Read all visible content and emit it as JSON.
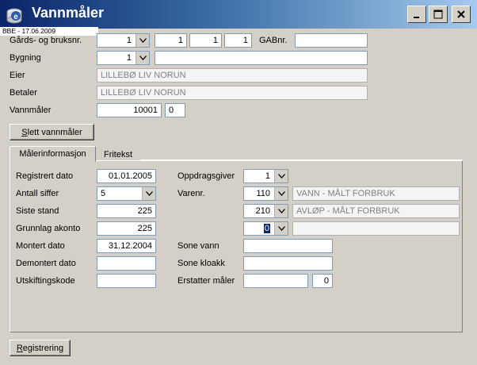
{
  "window": {
    "title": "Vannmåler",
    "version": "BBE - 17.06.2009",
    "icon": "app-logo-icon"
  },
  "property": {
    "gards_label": "Gårds- og bruksnr.",
    "kommune_value": "1",
    "gards_no": "1",
    "bruks_no": "1",
    "fest_no": "1",
    "gab_label": "GABnr.",
    "gab_value": "",
    "bygning_label": "Bygning",
    "bygning_value": "1",
    "bygning_text": "",
    "eier_label": "Eier",
    "eier_value": "LILLEBØ LIV NORUN",
    "betaler_label": "Betaler",
    "betaler_value": "LILLEBØ LIV NORUN",
    "vannmaler_label": "Vannmåler",
    "vannmaler_value": "10001",
    "vannmaler_sub": "0",
    "delete_button": "Slett vannmåler"
  },
  "tabs": [
    {
      "label": "Målerinformasjon",
      "active": true
    },
    {
      "label": "Fritekst",
      "active": false
    }
  ],
  "meter": {
    "registrert_label": "Registrert dato",
    "registrert_value": "01.01.2005",
    "antall_label": "Antall siffer",
    "antall_value": "5",
    "siste_label": "Siste stand",
    "siste_value": "225",
    "grunnlag_label": "Grunnlag akonto",
    "grunnlag_value": "225",
    "montert_label": "Montert dato",
    "montert_value": "31.12.2004",
    "demontert_label": "Demontert dato",
    "demontert_value": "",
    "utskift_label": "Utskiftingskode",
    "utskift_value": "",
    "oppdrag_label": "Oppdragsgiver",
    "oppdrag_value": "1",
    "varenr_label": "Varenr.",
    "varenr_rows": [
      {
        "code": "110",
        "desc": "VANN - MÅLT FORBRUK"
      },
      {
        "code": "210",
        "desc": "AVLØP - MÅLT FORBRUK"
      },
      {
        "code": "0",
        "desc": ""
      }
    ],
    "sone_vann_label": "Sone vann",
    "sone_vann_value": "",
    "sone_kloakk_label": "Sone kloakk",
    "sone_kloakk_value": "",
    "erstatter_label": "Erstatter måler",
    "erstatter_value": "",
    "erstatter_sub": "0"
  },
  "footer": {
    "registrering_button": "Registrering"
  }
}
